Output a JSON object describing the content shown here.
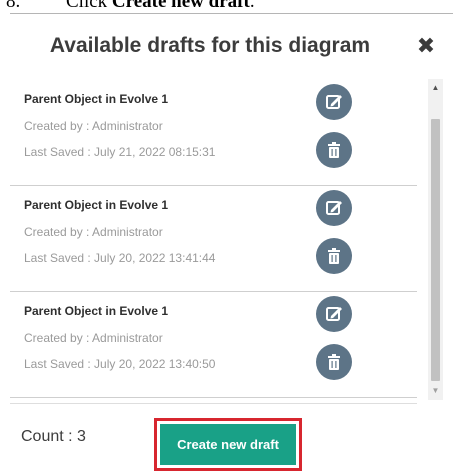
{
  "instruction": {
    "step_number": "8.",
    "prefix": "Click ",
    "emphasis": "Create new draft",
    "suffix": "."
  },
  "dialog": {
    "title": "Available drafts for this diagram",
    "close_icon": "close-icon"
  },
  "drafts": [
    {
      "name": "Parent Object in Evolve 1",
      "created_by": "Created by : Administrator",
      "last_saved": "Last Saved : July 21, 2022 08:15:31"
    },
    {
      "name": "Parent Object in Evolve 1",
      "created_by": "Created by : Administrator",
      "last_saved": "Last Saved : July 20, 2022 13:41:44"
    },
    {
      "name": "Parent Object in Evolve 1",
      "created_by": "Created by : Administrator",
      "last_saved": "Last Saved : July 20, 2022 13:40:50"
    }
  ],
  "icons": {
    "edit": "edit-icon",
    "delete": "trash-icon"
  },
  "footer": {
    "count_label": "Count : 3",
    "create_button": "Create new draft"
  },
  "colors": {
    "action_circle": "#5d7487",
    "create_button": "#19a187",
    "highlight_border": "#d7262f"
  }
}
